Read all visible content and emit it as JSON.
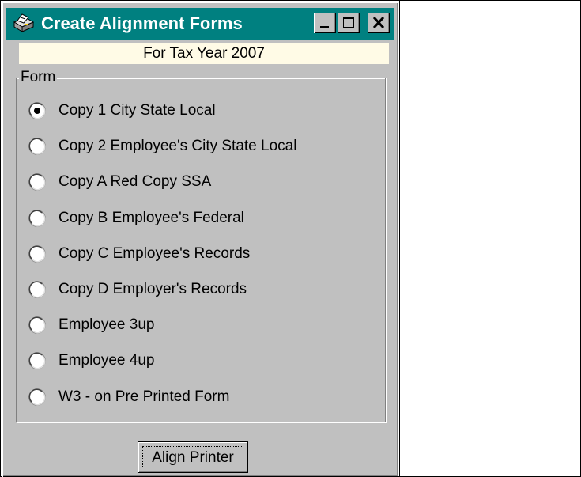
{
  "window": {
    "title": "Create Alignment Forms",
    "subtitle": "For Tax Year 2007",
    "title_bar_color": "#008080",
    "icon": "printer-icon"
  },
  "form_group": {
    "legend": "Form",
    "selected_index": 0,
    "options": [
      "Copy 1  City State Local",
      "Copy 2  Employee's City State Local",
      "Copy A  Red Copy SSA",
      "Copy B  Employee's Federal",
      "Copy C  Employee's Records",
      "Copy D  Employer's Records",
      "Employee 3up",
      "Employee 4up",
      "W3 - on Pre Printed Form"
    ]
  },
  "actions": {
    "align_printer_label": "Align Printer"
  }
}
